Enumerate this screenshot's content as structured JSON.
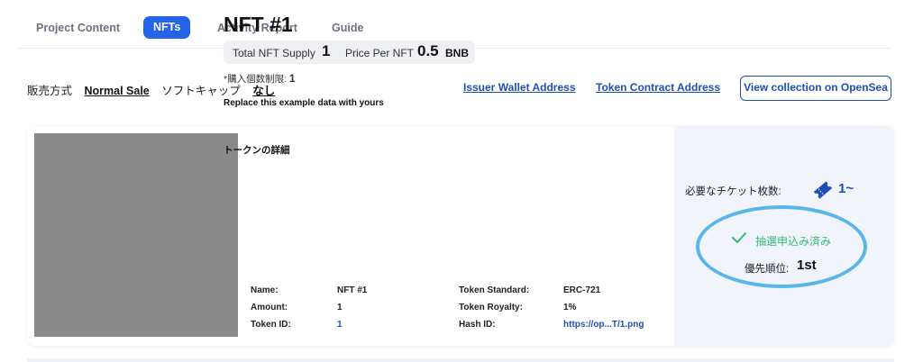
{
  "tabs": [
    {
      "label": "Project Content",
      "active": false
    },
    {
      "label": "NFTs",
      "active": true
    },
    {
      "label": "Activity Report",
      "active": false
    },
    {
      "label": "Guide",
      "active": false
    }
  ],
  "sale": {
    "method_label": "販売方式",
    "method_value": "Normal Sale",
    "softcap_label": "ソフトキャップ",
    "softcap_value": "なし"
  },
  "links": {
    "issuer_wallet": "Issuer Wallet Address",
    "token_contract": "Token Contract Address",
    "opensea_button": "View collection on OpenSea"
  },
  "nft": {
    "title": "NFT #1",
    "total_supply_label": "Total NFT Supply",
    "total_supply_value": "1",
    "price_label": "Price Per NFT",
    "price_value": "0.5",
    "price_unit": "BNB",
    "limit_label": "*購入個数制限: ",
    "limit_value": "1",
    "description": "Replace this example data with yours",
    "details_title": "トークンの詳細",
    "details": {
      "name_label": "Name:",
      "name_value": "NFT #1",
      "amount_label": "Amount:",
      "amount_value": "1",
      "token_id_label": "Token ID:",
      "token_id_value": "1",
      "standard_label": "Token Standard:",
      "standard_value": "ERC-721",
      "royalty_label": "Token Royalty:",
      "royalty_value": "1%",
      "hash_label": "Hash ID:",
      "hash_value": "https://op...T/1.png"
    }
  },
  "side": {
    "ticket_label": "必要なチケット枚数:",
    "ticket_value": "1~",
    "lottery_status": "抽選申込み済み",
    "rank_label": "優先順位:",
    "rank_value": "1st"
  },
  "colors": {
    "accent": "#2563eb",
    "link": "#1e4fb8",
    "success": "#2fbf71",
    "highlight_circle": "#58b7e8"
  }
}
